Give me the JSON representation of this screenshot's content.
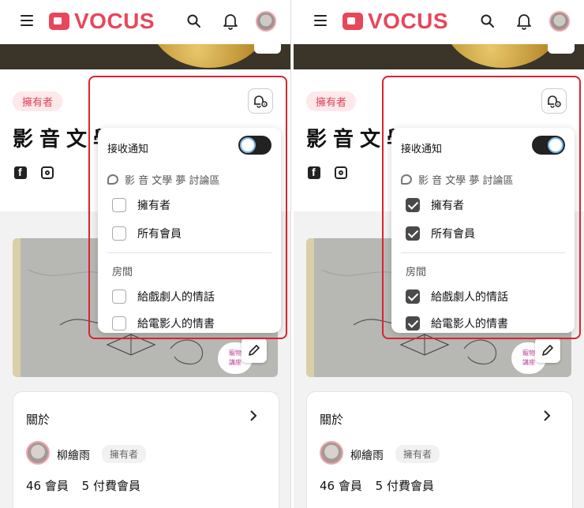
{
  "app": {
    "logo_text": "VOCUS",
    "brand_color": "#e8465a",
    "highlight_color": "#d9232d"
  },
  "header_icons": [
    "menu-icon",
    "search-icon",
    "bell-icon",
    "avatar"
  ],
  "page": {
    "badge": "擁有者",
    "title": "影音文學夢",
    "social_icons": [
      "facebook-icon",
      "instagram-icon"
    ],
    "artwork_caption": [
      "寵物",
      "講座"
    ]
  },
  "about": {
    "title": "關於",
    "author_name": "柳繪雨",
    "author_role": "擁有者",
    "members": "46 會員",
    "paid_members": "5 付費會員"
  },
  "screens": [
    {
      "id": "left",
      "notify_label": "接收通知",
      "toggle_on": false,
      "discussion_label": "影 音 文學 夢 討論區",
      "discussion_options": [
        {
          "label": "擁有者",
          "checked": false
        },
        {
          "label": "所有會員",
          "checked": false
        }
      ],
      "rooms_label": "房間",
      "room_options": [
        {
          "label": "給戲劇人的情話",
          "checked": false
        },
        {
          "label": "給電影人的情書",
          "checked": false
        }
      ]
    },
    {
      "id": "right",
      "notify_label": "接收通知",
      "toggle_on": true,
      "discussion_label": "影 音 文學 夢 討論區",
      "discussion_options": [
        {
          "label": "擁有者",
          "checked": true
        },
        {
          "label": "所有會員",
          "checked": true
        }
      ],
      "rooms_label": "房間",
      "room_options": [
        {
          "label": "給戲劇人的情話",
          "checked": true
        },
        {
          "label": "給電影人的情書",
          "checked": true
        }
      ]
    }
  ]
}
